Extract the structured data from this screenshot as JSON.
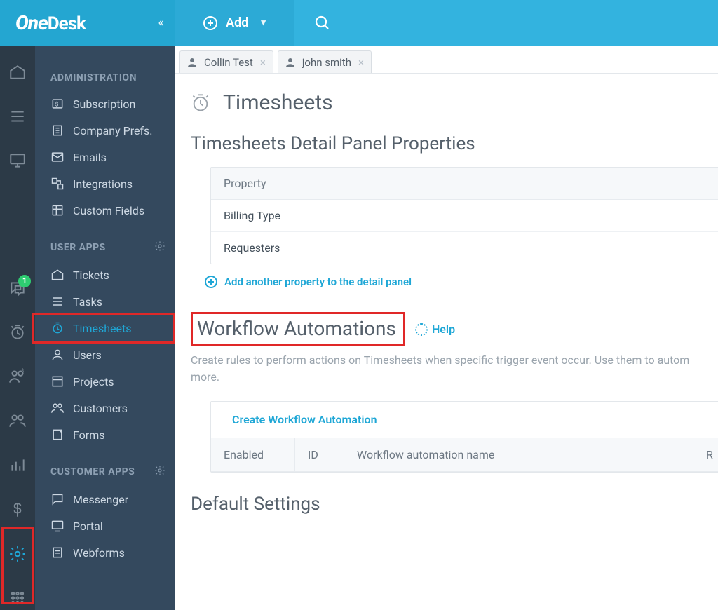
{
  "brand": {
    "one": "One",
    "desk": "Desk"
  },
  "topbar": {
    "add_label": "Add"
  },
  "tabs": [
    {
      "label": "Collin Test"
    },
    {
      "label": "john smith"
    }
  ],
  "rail_badge": "1",
  "sidebar": {
    "section_admin": "ADMINISTRATION",
    "section_user": "USER APPS",
    "section_customer": "CUSTOMER APPS",
    "admin_items": [
      {
        "label": "Subscription"
      },
      {
        "label": "Company Prefs."
      },
      {
        "label": "Emails"
      },
      {
        "label": "Integrations"
      },
      {
        "label": "Custom Fields"
      }
    ],
    "user_items": [
      {
        "label": "Tickets"
      },
      {
        "label": "Tasks"
      },
      {
        "label": "Timesheets"
      },
      {
        "label": "Users"
      },
      {
        "label": "Projects"
      },
      {
        "label": "Customers"
      },
      {
        "label": "Forms"
      }
    ],
    "customer_items": [
      {
        "label": "Messenger"
      },
      {
        "label": "Portal"
      },
      {
        "label": "Webforms"
      }
    ]
  },
  "page": {
    "title": "Timesheets",
    "detail_section": "Timesheets Detail Panel Properties",
    "property_header": "Property",
    "properties": [
      "Billing Type",
      "Requesters"
    ],
    "add_property": "Add another property to the detail panel",
    "wa_title": "Workflow Automations",
    "help": "Help",
    "wa_desc": "Create rules to perform actions on Timesheets when specific trigger event occur. Use them to autom more.",
    "wa_create": "Create Workflow Automation",
    "wa_cols": {
      "c1": "Enabled",
      "c2": "ID",
      "c3": "Workflow automation name",
      "c4": "R"
    },
    "default_section": "Default Settings"
  }
}
